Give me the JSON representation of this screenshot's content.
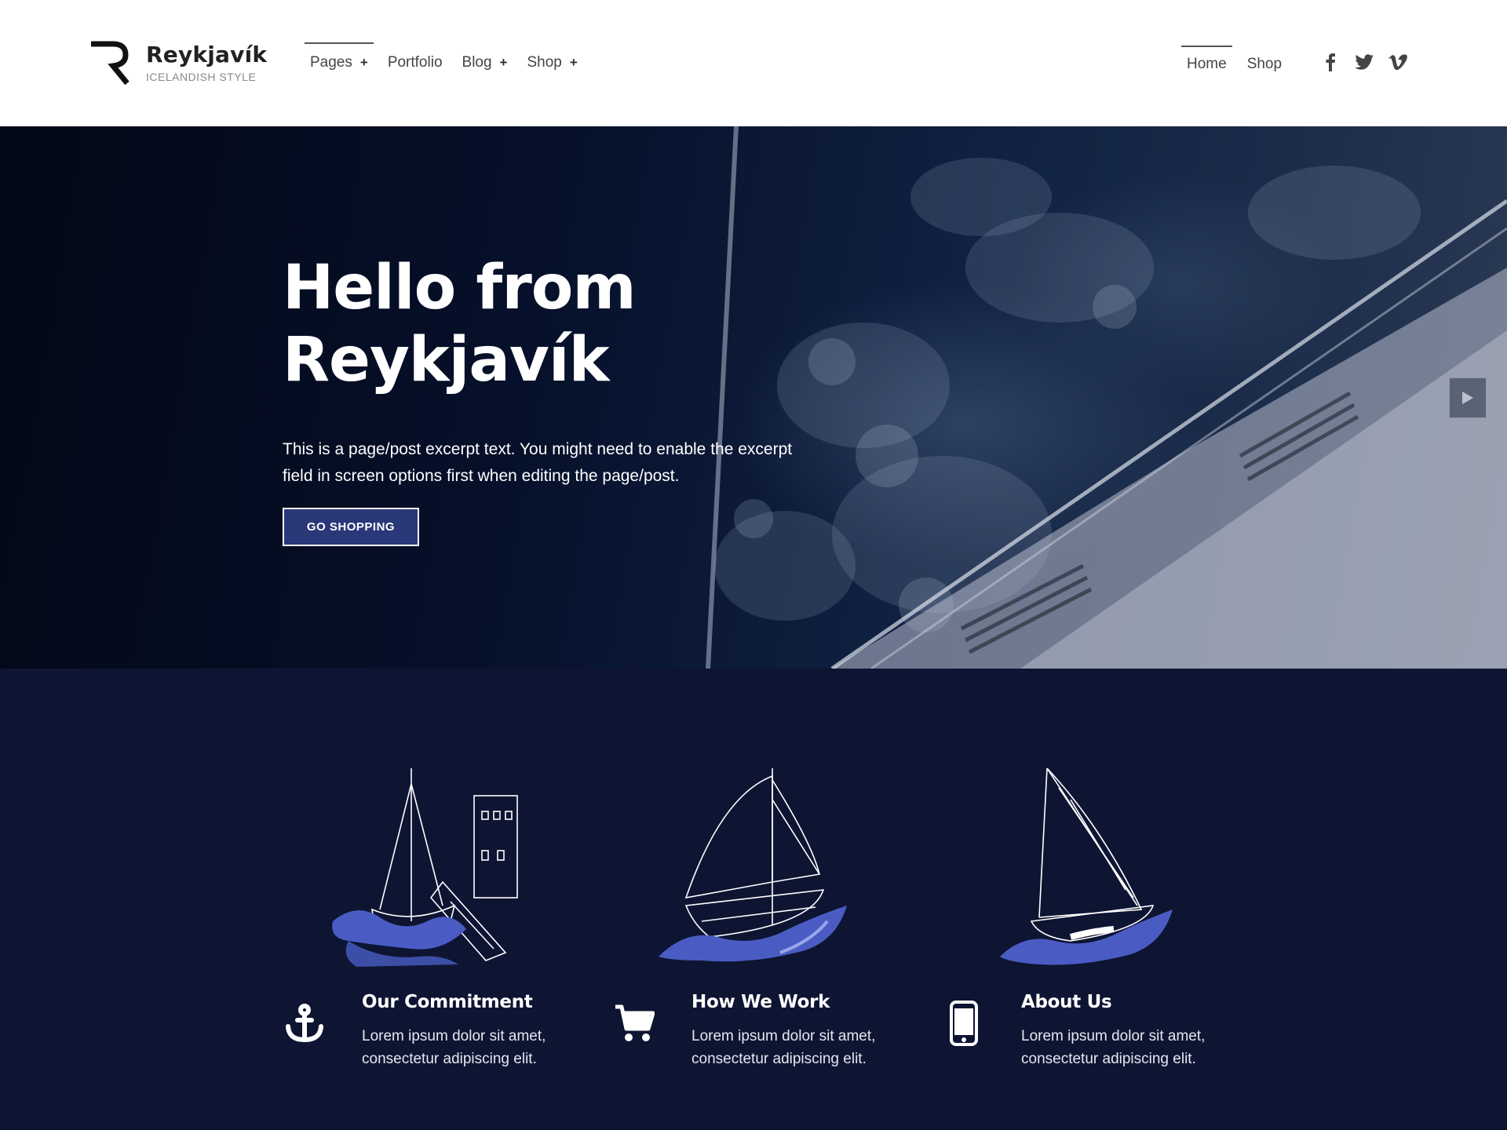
{
  "brand": {
    "title": "Reykjavík",
    "tagline": "ICELANDISH STYLE"
  },
  "nav_main": [
    {
      "label": "Pages",
      "has_submenu": true,
      "active": true
    },
    {
      "label": "Portfolio",
      "has_submenu": false,
      "active": false
    },
    {
      "label": "Blog",
      "has_submenu": true,
      "active": false
    },
    {
      "label": "Shop",
      "has_submenu": true,
      "active": false
    }
  ],
  "nav_secondary": [
    {
      "label": "Home",
      "active": true
    },
    {
      "label": "Shop",
      "active": false
    }
  ],
  "submenu_symbol": "+",
  "social": [
    "facebook-icon",
    "twitter-icon",
    "vimeo-icon"
  ],
  "hero": {
    "title_line1": "Hello from",
    "title_line2": "Reykjavík",
    "text": "This is a page/post excerpt text. You might need to enable the excerpt field in screen options first when editing the page/post.",
    "button_label": "GO SHOPPING"
  },
  "features": [
    {
      "icon": "anchor-icon",
      "illustration": "harbor-boat-illustration",
      "title": "Our Commitment",
      "text": "Lorem ipsum dolor sit amet, consectetur adipiscing elit."
    },
    {
      "icon": "cart-icon",
      "illustration": "sailboat-illustration",
      "title": "How We Work",
      "text": "Lorem ipsum dolor sit amet, consectetur adipiscing elit."
    },
    {
      "icon": "mobile-icon",
      "illustration": "yacht-illustration",
      "title": "About Us",
      "text": "Lorem ipsum dolor sit amet, consectetur adipiscing elit."
    }
  ],
  "colors": {
    "header_bg": "#ffffff",
    "features_bg": "#0e1533",
    "button_bg": "#2a3778",
    "wave_blue": "#4a5cc4"
  }
}
